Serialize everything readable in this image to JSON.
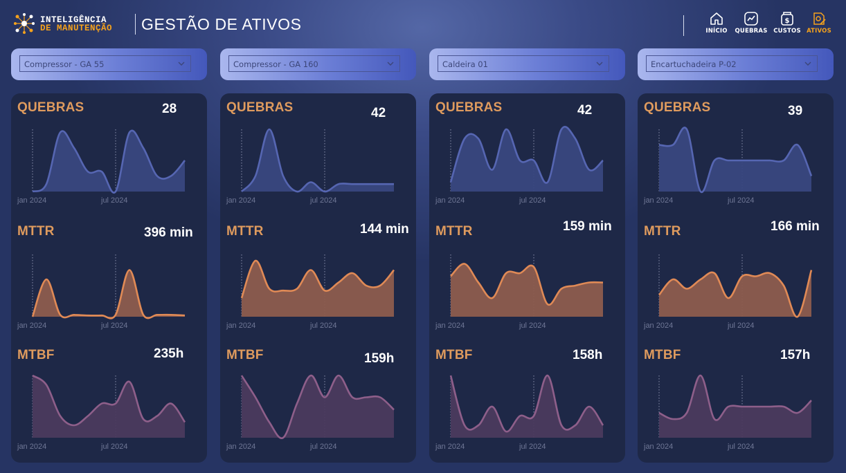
{
  "header": {
    "brand_line1": "INTELIGÊNCIA",
    "brand_line2": "DE MANUTENÇÃO",
    "title": "GESTÃO DE ATIVOS"
  },
  "nav": [
    {
      "label": "INÍCIO",
      "icon": "home-icon",
      "active": false
    },
    {
      "label": "QUEBRAS",
      "icon": "trend-chart-icon",
      "active": false
    },
    {
      "label": "CUSTOS",
      "icon": "dollar-box-icon",
      "active": false
    },
    {
      "label": "ATIVOS",
      "icon": "gear-edit-icon",
      "active": true
    }
  ],
  "colors": {
    "accent": "#f6a21c",
    "label": "#df9b5e",
    "quebras_fill": "#39477f",
    "quebras_line": "#5666b2",
    "mttr_fill": "#8d5c4e",
    "mttr_line": "#e08a56",
    "mtbf_fill": "#4b3a5e",
    "mtbf_line": "#8e5f8a",
    "card": "#1e2847"
  },
  "metric_labels": {
    "quebras": "QUEBRAS",
    "mttr": "MTTR",
    "mtbf": "MTBF"
  },
  "axis_ticks": [
    "jan 2024",
    "jul 2024"
  ],
  "assets": [
    {
      "dropdown": "Compressor - GA 55",
      "quebras_value": "28",
      "mttr_value": "396 min",
      "mtbf_value": "235h"
    },
    {
      "dropdown": "Compressor - GA 160",
      "quebras_value": "42",
      "mttr_value": "144 min",
      "mtbf_value": "159h"
    },
    {
      "dropdown": "Caldeira 01",
      "quebras_value": "42",
      "mttr_value": "159 min",
      "mtbf_value": "158h"
    },
    {
      "dropdown": "Encartuchadeira P-02",
      "quebras_value": "39",
      "mttr_value": "166 min",
      "mtbf_value": "157h"
    }
  ],
  "chart_data": [
    {
      "type": "area",
      "metric": "QUEBRAS",
      "asset": "Compressor - GA 55",
      "x": [
        "jan 2024",
        "fev",
        "mar",
        "abr",
        "mai",
        "jun",
        "jul 2024",
        "ago",
        "set",
        "out",
        "nov",
        "dez"
      ],
      "y": [
        0.0,
        0.12,
        0.95,
        0.7,
        0.32,
        0.32,
        0.0,
        0.95,
        0.7,
        0.25,
        0.25,
        0.5
      ],
      "ylim": [
        0,
        1
      ],
      "series_color": "#5666b2"
    },
    {
      "type": "area",
      "metric": "MTTR",
      "asset": "Compressor - GA 55",
      "x": [
        "jan 2024",
        "fev",
        "mar",
        "abr",
        "mai",
        "jun",
        "jul 2024",
        "ago",
        "set",
        "out",
        "nov",
        "dez"
      ],
      "y": [
        0.0,
        0.6,
        0.03,
        0.03,
        0.02,
        0.02,
        0.03,
        0.75,
        0.03,
        0.03,
        0.03,
        0.02
      ],
      "ylim": [
        0,
        1
      ],
      "series_color": "#e08a56"
    },
    {
      "type": "area",
      "metric": "MTBF",
      "asset": "Compressor - GA 55",
      "x": [
        "jan 2024",
        "fev",
        "mar",
        "abr",
        "mai",
        "jun",
        "jul 2024",
        "ago",
        "set",
        "out",
        "nov",
        "dez"
      ],
      "y": [
        1.0,
        0.85,
        0.35,
        0.2,
        0.35,
        0.55,
        0.55,
        0.9,
        0.3,
        0.35,
        0.55,
        0.25
      ],
      "ylim": [
        0,
        1
      ],
      "series_color": "#8e5f8a"
    },
    {
      "type": "area",
      "metric": "QUEBRAS",
      "asset": "Compressor - GA 160",
      "x": [
        "jan 2024",
        "fev",
        "mar",
        "abr",
        "mai",
        "jun",
        "jul 2024",
        "ago",
        "set",
        "out",
        "nov",
        "dez"
      ],
      "y": [
        0.0,
        0.25,
        1.0,
        0.25,
        0.0,
        0.15,
        0.0,
        0.12,
        0.12,
        0.12,
        0.12,
        0.12
      ],
      "ylim": [
        0,
        1
      ],
      "series_color": "#5666b2"
    },
    {
      "type": "area",
      "metric": "MTTR",
      "asset": "Compressor - GA 160",
      "x": [
        "jan 2024",
        "fev",
        "mar",
        "abr",
        "mai",
        "jun",
        "jul 2024",
        "ago",
        "set",
        "out",
        "nov",
        "dez"
      ],
      "y": [
        0.3,
        0.9,
        0.45,
        0.42,
        0.45,
        0.75,
        0.42,
        0.55,
        0.7,
        0.5,
        0.5,
        0.75
      ],
      "ylim": [
        0,
        1
      ],
      "series_color": "#e08a56"
    },
    {
      "type": "area",
      "metric": "MTBF",
      "asset": "Compressor - GA 160",
      "x": [
        "jan 2024",
        "fev",
        "mar",
        "abr",
        "mai",
        "jun",
        "jul 2024",
        "ago",
        "set",
        "out",
        "nov",
        "dez"
      ],
      "y": [
        1.0,
        0.65,
        0.25,
        0.0,
        0.55,
        1.0,
        0.65,
        1.0,
        0.65,
        0.65,
        0.65,
        0.45
      ],
      "ylim": [
        0,
        1
      ],
      "series_color": "#8e5f8a"
    },
    {
      "type": "area",
      "metric": "QUEBRAS",
      "asset": "Caldeira 01",
      "x": [
        "jan 2024",
        "fev",
        "mar",
        "abr",
        "mai",
        "jun",
        "jul 2024",
        "ago",
        "set",
        "out",
        "nov",
        "dez"
      ],
      "y": [
        0.15,
        0.85,
        0.85,
        0.35,
        1.0,
        0.5,
        0.5,
        0.15,
        1.0,
        0.85,
        0.35,
        0.5
      ],
      "ylim": [
        0,
        1
      ],
      "series_color": "#5666b2"
    },
    {
      "type": "area",
      "metric": "MTTR",
      "asset": "Caldeira 01",
      "x": [
        "jan 2024",
        "fev",
        "mar",
        "abr",
        "mai",
        "jun",
        "jul 2024",
        "ago",
        "set",
        "out",
        "nov",
        "dez"
      ],
      "y": [
        0.65,
        0.85,
        0.55,
        0.3,
        0.7,
        0.7,
        0.8,
        0.2,
        0.45,
        0.5,
        0.55,
        0.55
      ],
      "ylim": [
        0,
        1
      ],
      "series_color": "#e08a56"
    },
    {
      "type": "area",
      "metric": "MTBF",
      "asset": "Caldeira 01",
      "x": [
        "jan 2024",
        "fev",
        "mar",
        "abr",
        "mai",
        "jun",
        "jul 2024",
        "ago",
        "set",
        "out",
        "nov",
        "dez"
      ],
      "y": [
        1.0,
        0.2,
        0.2,
        0.5,
        0.1,
        0.35,
        0.35,
        1.0,
        0.2,
        0.2,
        0.5,
        0.2
      ],
      "ylim": [
        0,
        1
      ],
      "series_color": "#8e5f8a"
    },
    {
      "type": "area",
      "metric": "QUEBRAS",
      "asset": "Encartuchadeira P-02",
      "x": [
        "jan 2024",
        "fev",
        "mar",
        "abr",
        "mai",
        "jun",
        "jul 2024",
        "ago",
        "set",
        "out",
        "nov",
        "dez"
      ],
      "y": [
        0.75,
        0.75,
        1.0,
        0.0,
        0.5,
        0.5,
        0.5,
        0.5,
        0.5,
        0.5,
        0.75,
        0.25
      ],
      "ylim": [
        0,
        1
      ],
      "series_color": "#5666b2"
    },
    {
      "type": "area",
      "metric": "MTTR",
      "asset": "Encartuchadeira P-02",
      "x": [
        "jan 2024",
        "fev",
        "mar",
        "abr",
        "mai",
        "jun",
        "jul 2024",
        "ago",
        "set",
        "out",
        "nov",
        "dez"
      ],
      "y": [
        0.35,
        0.6,
        0.45,
        0.6,
        0.7,
        0.3,
        0.65,
        0.65,
        0.7,
        0.5,
        0.0,
        0.75
      ],
      "ylim": [
        0,
        1
      ],
      "series_color": "#e08a56"
    },
    {
      "type": "area",
      "metric": "MTBF",
      "asset": "Encartuchadeira P-02",
      "x": [
        "jan 2024",
        "fev",
        "mar",
        "abr",
        "mai",
        "jun",
        "jul 2024",
        "ago",
        "set",
        "out",
        "nov",
        "dez"
      ],
      "y": [
        0.4,
        0.3,
        0.4,
        1.0,
        0.3,
        0.5,
        0.5,
        0.5,
        0.5,
        0.5,
        0.4,
        0.6
      ],
      "ylim": [
        0,
        1
      ],
      "series_color": "#8e5f8a"
    }
  ]
}
